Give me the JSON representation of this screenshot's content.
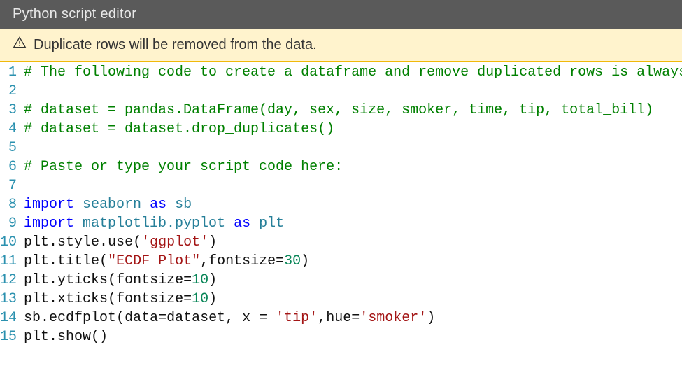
{
  "header": {
    "title": "Python script editor"
  },
  "warning": {
    "message": "Duplicate rows will be removed from the data."
  },
  "code": {
    "lines": [
      {
        "n": "1",
        "tokens": [
          {
            "cls": "c",
            "t": "# The following code to create a dataframe and remove duplicated rows is always"
          }
        ]
      },
      {
        "n": "2",
        "tokens": [
          {
            "cls": "",
            "t": ""
          }
        ]
      },
      {
        "n": "3",
        "tokens": [
          {
            "cls": "c",
            "t": "# dataset = pandas.DataFrame(day, sex, size, smoker, time, tip, total_bill)"
          }
        ]
      },
      {
        "n": "4",
        "tokens": [
          {
            "cls": "c",
            "t": "# dataset = dataset.drop_duplicates()"
          }
        ]
      },
      {
        "n": "5",
        "tokens": [
          {
            "cls": "",
            "t": ""
          }
        ]
      },
      {
        "n": "6",
        "tokens": [
          {
            "cls": "c",
            "t": "# Paste or type your script code here:"
          }
        ]
      },
      {
        "n": "7",
        "tokens": [
          {
            "cls": "",
            "t": ""
          }
        ]
      },
      {
        "n": "8",
        "tokens": [
          {
            "cls": "kw",
            "t": "import"
          },
          {
            "cls": "",
            "t": " "
          },
          {
            "cls": "mod",
            "t": "seaborn"
          },
          {
            "cls": "",
            "t": " "
          },
          {
            "cls": "kw",
            "t": "as"
          },
          {
            "cls": "",
            "t": " "
          },
          {
            "cls": "mod",
            "t": "sb"
          }
        ]
      },
      {
        "n": "9",
        "tokens": [
          {
            "cls": "kw",
            "t": "import"
          },
          {
            "cls": "",
            "t": " "
          },
          {
            "cls": "mod",
            "t": "matplotlib.pyplot"
          },
          {
            "cls": "",
            "t": " "
          },
          {
            "cls": "kw",
            "t": "as"
          },
          {
            "cls": "",
            "t": " "
          },
          {
            "cls": "mod",
            "t": "plt"
          }
        ]
      },
      {
        "n": "10",
        "tokens": [
          {
            "cls": "id",
            "t": "plt"
          },
          {
            "cls": "op",
            "t": "."
          },
          {
            "cls": "fn",
            "t": "style"
          },
          {
            "cls": "op",
            "t": "."
          },
          {
            "cls": "fn",
            "t": "use"
          },
          {
            "cls": "op",
            "t": "("
          },
          {
            "cls": "str",
            "t": "'ggplot'"
          },
          {
            "cls": "op",
            "t": ")"
          }
        ]
      },
      {
        "n": "11",
        "tokens": [
          {
            "cls": "id",
            "t": "plt"
          },
          {
            "cls": "op",
            "t": "."
          },
          {
            "cls": "fn",
            "t": "title"
          },
          {
            "cls": "op",
            "t": "("
          },
          {
            "cls": "str",
            "t": "\"ECDF Plot\""
          },
          {
            "cls": "op",
            "t": ","
          },
          {
            "cls": "id",
            "t": "fontsize"
          },
          {
            "cls": "op",
            "t": "="
          },
          {
            "cls": "num",
            "t": "30"
          },
          {
            "cls": "op",
            "t": ")"
          }
        ]
      },
      {
        "n": "12",
        "tokens": [
          {
            "cls": "id",
            "t": "plt"
          },
          {
            "cls": "op",
            "t": "."
          },
          {
            "cls": "fn",
            "t": "yticks"
          },
          {
            "cls": "op",
            "t": "("
          },
          {
            "cls": "id",
            "t": "fontsize"
          },
          {
            "cls": "op",
            "t": "="
          },
          {
            "cls": "num",
            "t": "10"
          },
          {
            "cls": "op",
            "t": ")"
          }
        ]
      },
      {
        "n": "13",
        "tokens": [
          {
            "cls": "id",
            "t": "plt"
          },
          {
            "cls": "op",
            "t": "."
          },
          {
            "cls": "fn",
            "t": "xticks"
          },
          {
            "cls": "op",
            "t": "("
          },
          {
            "cls": "id",
            "t": "fontsize"
          },
          {
            "cls": "op",
            "t": "="
          },
          {
            "cls": "num",
            "t": "10"
          },
          {
            "cls": "op",
            "t": ")"
          }
        ]
      },
      {
        "n": "14",
        "tokens": [
          {
            "cls": "id",
            "t": "sb"
          },
          {
            "cls": "op",
            "t": "."
          },
          {
            "cls": "fn",
            "t": "ecdfplot"
          },
          {
            "cls": "op",
            "t": "("
          },
          {
            "cls": "id",
            "t": "data"
          },
          {
            "cls": "op",
            "t": "="
          },
          {
            "cls": "id",
            "t": "dataset"
          },
          {
            "cls": "op",
            "t": ", "
          },
          {
            "cls": "id",
            "t": "x"
          },
          {
            "cls": "op",
            "t": " = "
          },
          {
            "cls": "str",
            "t": "'tip'"
          },
          {
            "cls": "op",
            "t": ","
          },
          {
            "cls": "id",
            "t": "hue"
          },
          {
            "cls": "op",
            "t": "="
          },
          {
            "cls": "str",
            "t": "'smoker'"
          },
          {
            "cls": "op",
            "t": ")"
          }
        ]
      },
      {
        "n": "15",
        "tokens": [
          {
            "cls": "id",
            "t": "plt"
          },
          {
            "cls": "op",
            "t": "."
          },
          {
            "cls": "fn",
            "t": "show"
          },
          {
            "cls": "op",
            "t": "()"
          }
        ]
      }
    ]
  }
}
